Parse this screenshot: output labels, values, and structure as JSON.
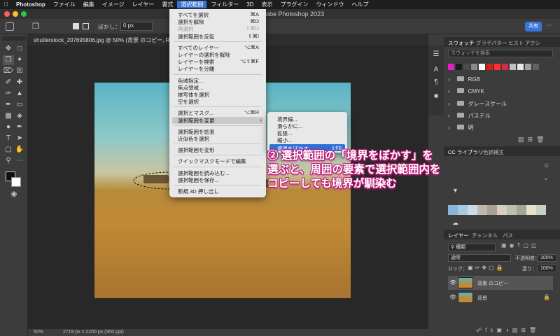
{
  "menubar": {
    "items": [
      "Photoshop",
      "ファイル",
      "編集",
      "イメージ",
      "レイヤー",
      "書式",
      "選択範囲",
      "フィルター",
      "3D",
      "表示",
      "プラグイン",
      "ウィンドウ",
      "ヘルプ"
    ],
    "active": "選択範囲"
  },
  "window": {
    "title": "obe Photoshop 2023"
  },
  "options": {
    "feather_label": "ぼかし：",
    "feather_value": "0 px",
    "share": "共有"
  },
  "document": {
    "tab": "shutterstock_207695806.jpg @ 50% (背景 のコピー, RGB/8"
  },
  "status": {
    "zoom": "50%",
    "size": "2719 px x 2200 px (300 ppi)"
  },
  "select_menu": {
    "groups": [
      [
        {
          "label": "すべてを選択",
          "shortcut": "⌘A"
        },
        {
          "label": "選択を解除",
          "shortcut": "⌘D"
        },
        {
          "label": "再選択",
          "shortcut": "⇧⌘D",
          "disabled": true
        },
        {
          "label": "選択範囲を反転",
          "shortcut": "⇧⌘I"
        }
      ],
      [
        {
          "label": "すべてのレイヤー",
          "shortcut": "⌥⌘A"
        },
        {
          "label": "レイヤーの選択を解除",
          "shortcut": ""
        },
        {
          "label": "レイヤーを検索",
          "shortcut": "⌥⇧⌘F"
        },
        {
          "label": "レイヤーを分離",
          "shortcut": ""
        }
      ],
      [
        {
          "label": "色域指定...",
          "shortcut": ""
        },
        {
          "label": "焦点領域...",
          "shortcut": ""
        },
        {
          "label": "被写体を選択",
          "shortcut": ""
        },
        {
          "label": "空を選択",
          "shortcut": ""
        }
      ],
      [
        {
          "label": "選択とマスク...",
          "shortcut": "⌥⌘R"
        },
        {
          "label": "選択範囲を変更",
          "shortcut": "",
          "submenu": true
        }
      ],
      [
        {
          "label": "選択範囲を拡張",
          "shortcut": ""
        },
        {
          "label": "近似色を選択",
          "shortcut": ""
        }
      ],
      [
        {
          "label": "選択範囲を変形",
          "shortcut": ""
        }
      ],
      [
        {
          "label": "クイックマスクモードで編集",
          "shortcut": ""
        }
      ],
      [
        {
          "label": "選択範囲を読み込む...",
          "shortcut": ""
        },
        {
          "label": "選択範囲を保存...",
          "shortcut": ""
        }
      ],
      [
        {
          "label": "新規 3D 押し出し",
          "shortcut": ""
        }
      ]
    ]
  },
  "modify_submenu": {
    "items": [
      "境界線...",
      "滑らかに...",
      "拡張...",
      "縮小...",
      "境界をぼかす..."
    ],
    "selected": "境界をぼかす...",
    "selected_shortcut": "⇧F6"
  },
  "annotation": {
    "line1": "② 選択範囲の「境界をぼかす」を",
    "line2": "選ぶと、周囲の要素で選択範囲内を",
    "line3": "コピーしても境界が馴染む"
  },
  "swatches_panel": {
    "tabs": [
      "スウォッチ",
      "グラデ",
      "パター",
      "ヒスト",
      "アクシ"
    ],
    "search_placeholder": "スウォッチを検索",
    "colors": [
      "#e020c0",
      "#1a1a1a",
      "#4a4a4a",
      "#8a8a8a",
      "#ffffff",
      "#e01b1b",
      "#ff3030",
      "#d42a4a",
      "#c0c0c0",
      "#e8e8e8",
      "#a0a0a0",
      "#606060"
    ],
    "folders": [
      "RGB",
      "CMYK",
      "グレースケール",
      "パステル",
      "明"
    ]
  },
  "cc_panel": {
    "tabs": [
      "CC ライブラリ",
      "色調補正"
    ],
    "palette": [
      "#8ab4d8",
      "#a8c8e0",
      "#c8dce8",
      "#c0b8a8",
      "#a8a098",
      "#d8d0b8",
      "#b8c0b0",
      "#a0a890",
      "#e8e0c8",
      "#c8d0c0"
    ]
  },
  "layers_panel": {
    "tabs": [
      "レイヤー",
      "チャンネル",
      "パス"
    ],
    "filter": "種類",
    "blend": "通常",
    "opacity_label": "不透明度：",
    "opacity": "100%",
    "lock_label": "ロック：",
    "fill_label": "塗り：",
    "fill": "100%",
    "layers": [
      "背景 のコピー",
      "背景"
    ]
  }
}
